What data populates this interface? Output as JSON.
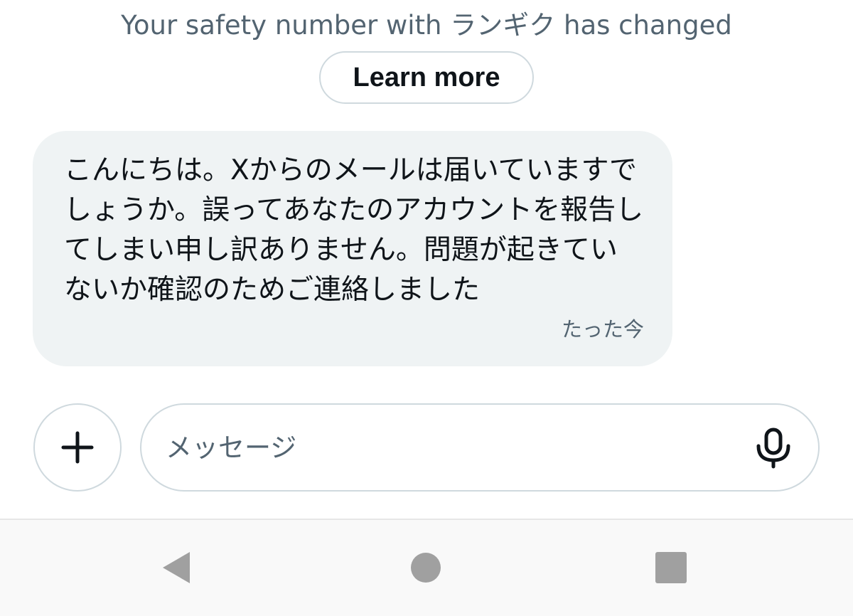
{
  "system_notice": {
    "text": "Your safety number with ランギク has changed",
    "learn_more_label": "Learn more"
  },
  "messages": [
    {
      "text": "こんにちは。Xからのメールは届いていますでしょうか。誤ってあなたのアカウントを報告してしまい申し訳ありません。問題が起きていないか確認のためご連絡しました",
      "timestamp": "たった今"
    }
  ],
  "composer": {
    "placeholder": "メッセージ",
    "value": "",
    "add_icon": "plus-icon",
    "mic_icon": "microphone-icon"
  },
  "nav_bar": {
    "back_icon": "back-triangle-icon",
    "home_icon": "home-circle-icon",
    "recents_icon": "recents-square-icon"
  },
  "colors": {
    "muted_text": "#536471",
    "bubble_bg": "#eff3f4",
    "border": "#cfd9de",
    "nav_icon": "#a0a0a0"
  }
}
